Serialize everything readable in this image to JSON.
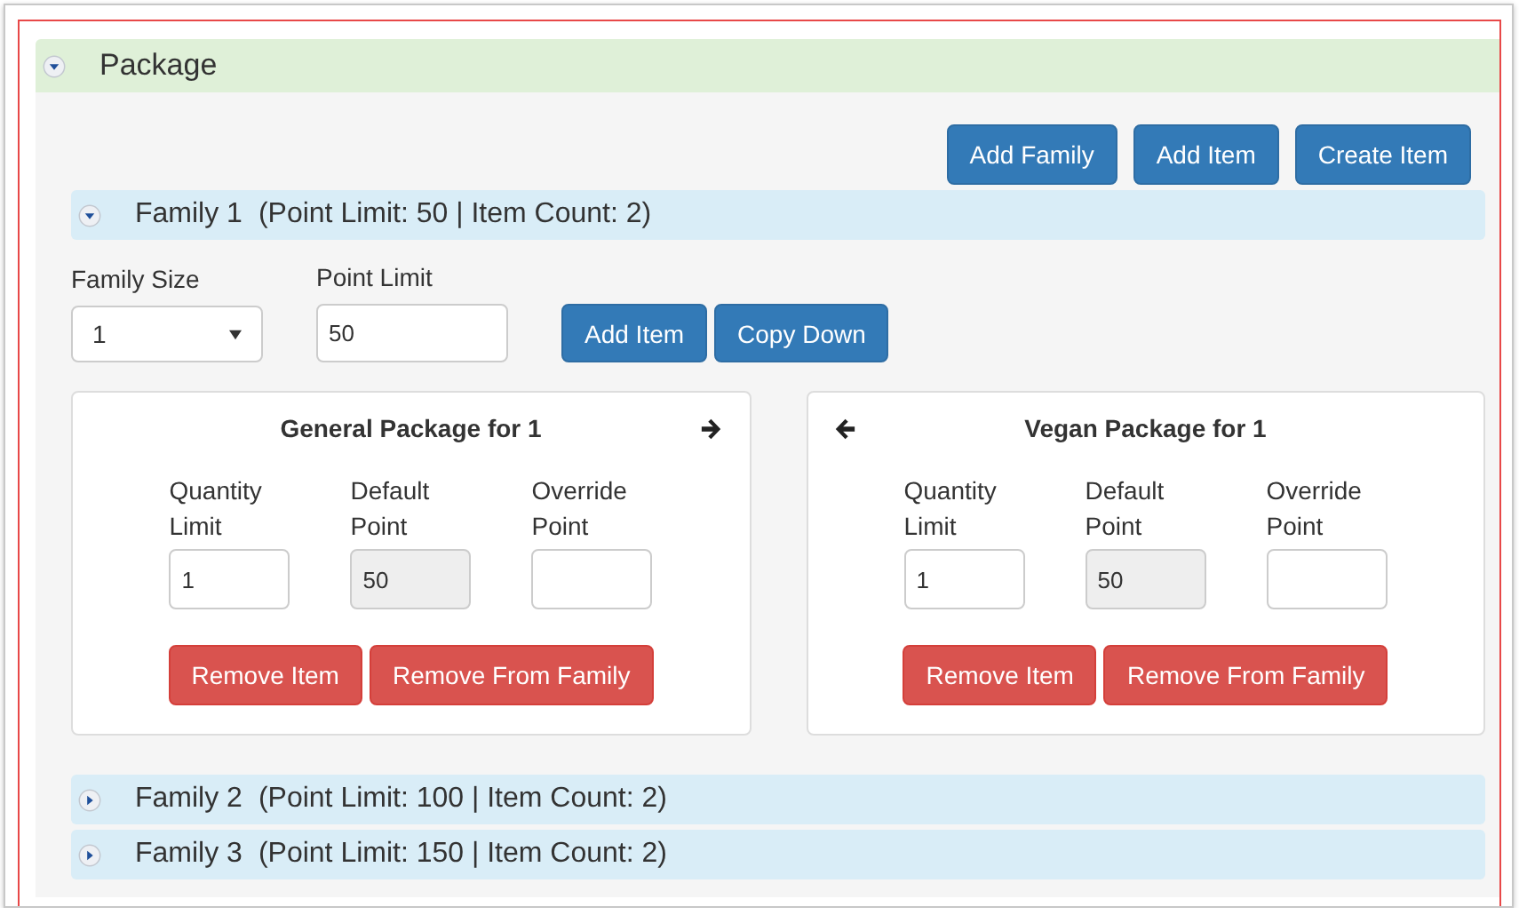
{
  "section": {
    "title": "Package",
    "expanded": true
  },
  "toolbar_buttons": [
    "Add Family",
    "Add Item",
    "Create Item"
  ],
  "families": [
    {
      "title": "Family 1",
      "summary": "(Point Limit: 50 | Item Count: 2)",
      "expanded": true,
      "family_size": {
        "label": "Family Size",
        "value": "1"
      },
      "point_limit": {
        "label": "Point Limit",
        "value": "50"
      },
      "buttons": [
        "Add Item",
        "Copy Down"
      ],
      "cards": [
        {
          "title": "General Package for 1",
          "prev_arrow": false,
          "next_arrow": true,
          "fields": [
            {
              "label": "Quantity Limit",
              "value": "1",
              "disabled": false
            },
            {
              "label": "Default Point",
              "value": "50",
              "disabled": true
            },
            {
              "label": "Override Point",
              "disabled": false
            }
          ],
          "buttons": [
            "Remove Item",
            "Remove From Family"
          ]
        },
        {
          "title": "Vegan Package for 1",
          "prev_arrow": true,
          "next_arrow": false,
          "fields": [
            {
              "label": "Quantity Limit",
              "value": "1",
              "disabled": false
            },
            {
              "label": "Default Point",
              "value": "50",
              "disabled": true
            },
            {
              "label": "Override Point",
              "disabled": false
            }
          ],
          "buttons": [
            "Remove Item",
            "Remove From Family"
          ]
        }
      ]
    },
    {
      "title": "Family 2",
      "summary": "(Point Limit: 100 | Item Count: 2)",
      "expanded": false
    },
    {
      "title": "Family 3",
      "summary": "(Point Limit: 150 | Item Count: 2)",
      "expanded": false
    }
  ]
}
